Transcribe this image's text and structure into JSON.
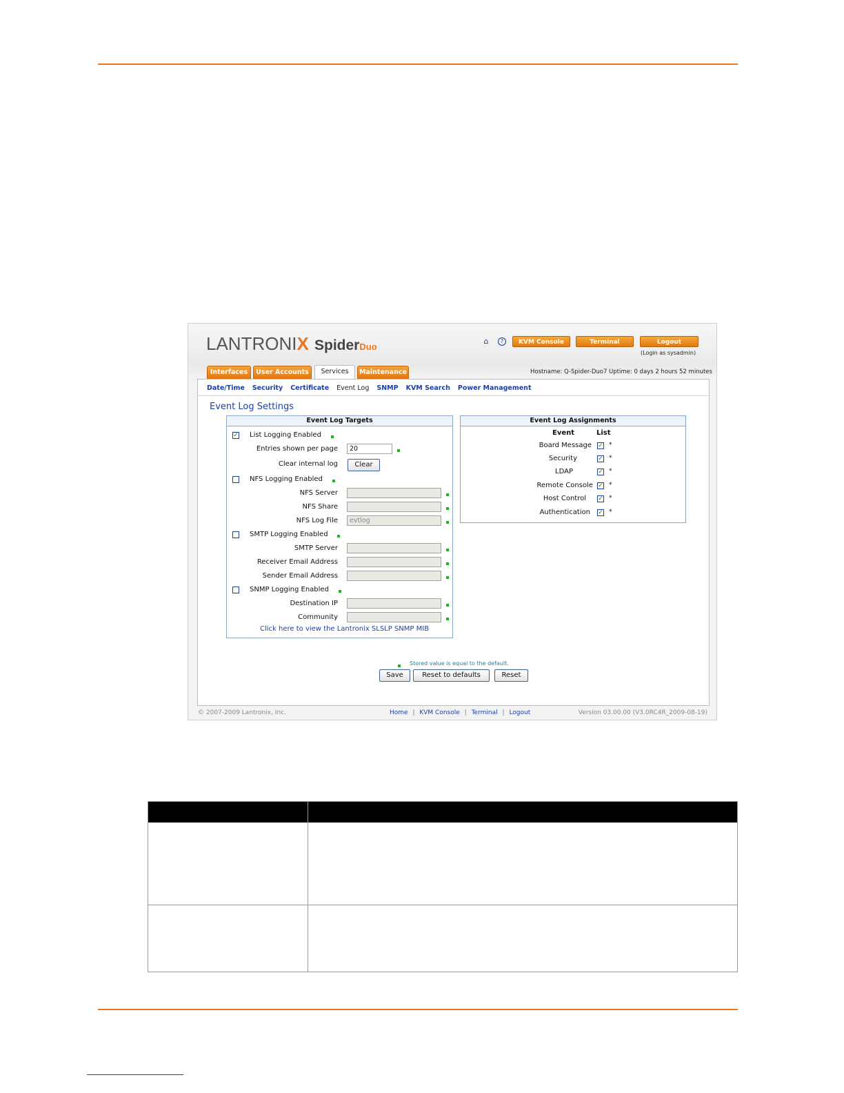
{
  "screen": {
    "brand": {
      "lantronix": "LANTRONI",
      "lantronix_x": "X",
      "spider": "Spider",
      "duo": "Duo"
    },
    "top_buttons": {
      "kvm_console": "KVM Console",
      "terminal": "Terminal",
      "logout": "Logout"
    },
    "login_as": "(Login as sysadmin)",
    "tabs": [
      "Interfaces",
      "User Accounts",
      "Services",
      "Maintenance"
    ],
    "active_tab": "Services",
    "hostname_line": "Hostname: Q-Spider-Duo7    Uptime: 0 days 2 hours 52 minutes",
    "subnav": [
      "Date/Time",
      "Security",
      "Certificate",
      "Event Log",
      "SNMP",
      "KVM Search",
      "Power Management"
    ],
    "current_subnav": "Event Log",
    "title": "Event Log Settings",
    "targets": {
      "header": "Event Log Targets",
      "list_logging_enabled": "List Logging Enabled",
      "entries_per_page": "Entries shown per page",
      "entries_value": "20",
      "clear_internal_log": "Clear internal log",
      "clear_button": "Clear",
      "nfs_logging_enabled": "NFS Logging Enabled",
      "nfs_server": "NFS Server",
      "nfs_share": "NFS Share",
      "nfs_log_file": "NFS Log File",
      "nfs_log_file_value": "evtlog",
      "smtp_logging_enabled": "SMTP Logging Enabled",
      "smtp_server": "SMTP Server",
      "receiver_email": "Receiver Email Address",
      "sender_email": "Sender Email Address",
      "snmp_logging_enabled": "SNMP Logging Enabled",
      "destination_ip": "Destination IP",
      "community": "Community",
      "mib_link": "Click here to view the Lantronix SLSLP SNMP MIB"
    },
    "assignments": {
      "header": "Event Log Assignments",
      "col_event": "Event",
      "col_list": "List",
      "events": [
        "Board Message",
        "Security",
        "LDAP",
        "Remote Console",
        "Host Control",
        "Authentication"
      ],
      "star": "*"
    },
    "legend": "Stored value is equal to the default.",
    "buttons": {
      "save": "Save",
      "reset_defaults": "Reset to defaults",
      "reset": "Reset"
    },
    "footer": {
      "copyright": "© 2007-2009 Lantronix, Inc.",
      "links": [
        "Home",
        "KVM Console",
        "Terminal",
        "Logout"
      ],
      "separator": "|",
      "version": "Version 03.00.00 (V3.0RC4R_2009-08-19)"
    }
  },
  "colors": {
    "accent_orange": "#e87722",
    "link_blue": "#1f3fa0",
    "default_marker": "#22b022"
  }
}
